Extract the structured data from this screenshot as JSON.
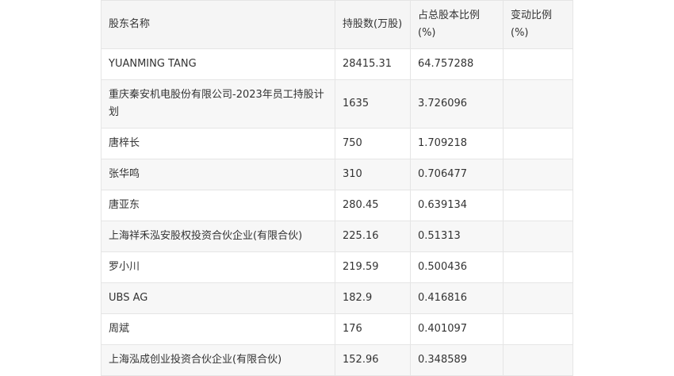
{
  "table": {
    "headers": [
      "股东名称",
      "持股数(万股)",
      "占总股本比例(%)",
      "变动比例(%)"
    ],
    "rows": [
      [
        "YUANMING TANG",
        "28415.31",
        "64.757288",
        ""
      ],
      [
        "重庆秦安机电股份有限公司-2023年员工持股计划",
        "1635",
        "3.726096",
        ""
      ],
      [
        "唐梓长",
        "750",
        "1.709218",
        ""
      ],
      [
        "张华鸣",
        "310",
        "0.706477",
        ""
      ],
      [
        "唐亚东",
        "280.45",
        "0.639134",
        ""
      ],
      [
        "上海祥禾泓安股权投资合伙企业(有限合伙)",
        "225.16",
        "0.51313",
        ""
      ],
      [
        "罗小川",
        "219.59",
        "0.500436",
        ""
      ],
      [
        "UBS AG",
        "182.9",
        "0.416816",
        ""
      ],
      [
        "周斌",
        "176",
        "0.401097",
        ""
      ],
      [
        "上海泓成创业投资合伙企业(有限合伙)",
        "152.96",
        "0.348589",
        ""
      ]
    ]
  }
}
